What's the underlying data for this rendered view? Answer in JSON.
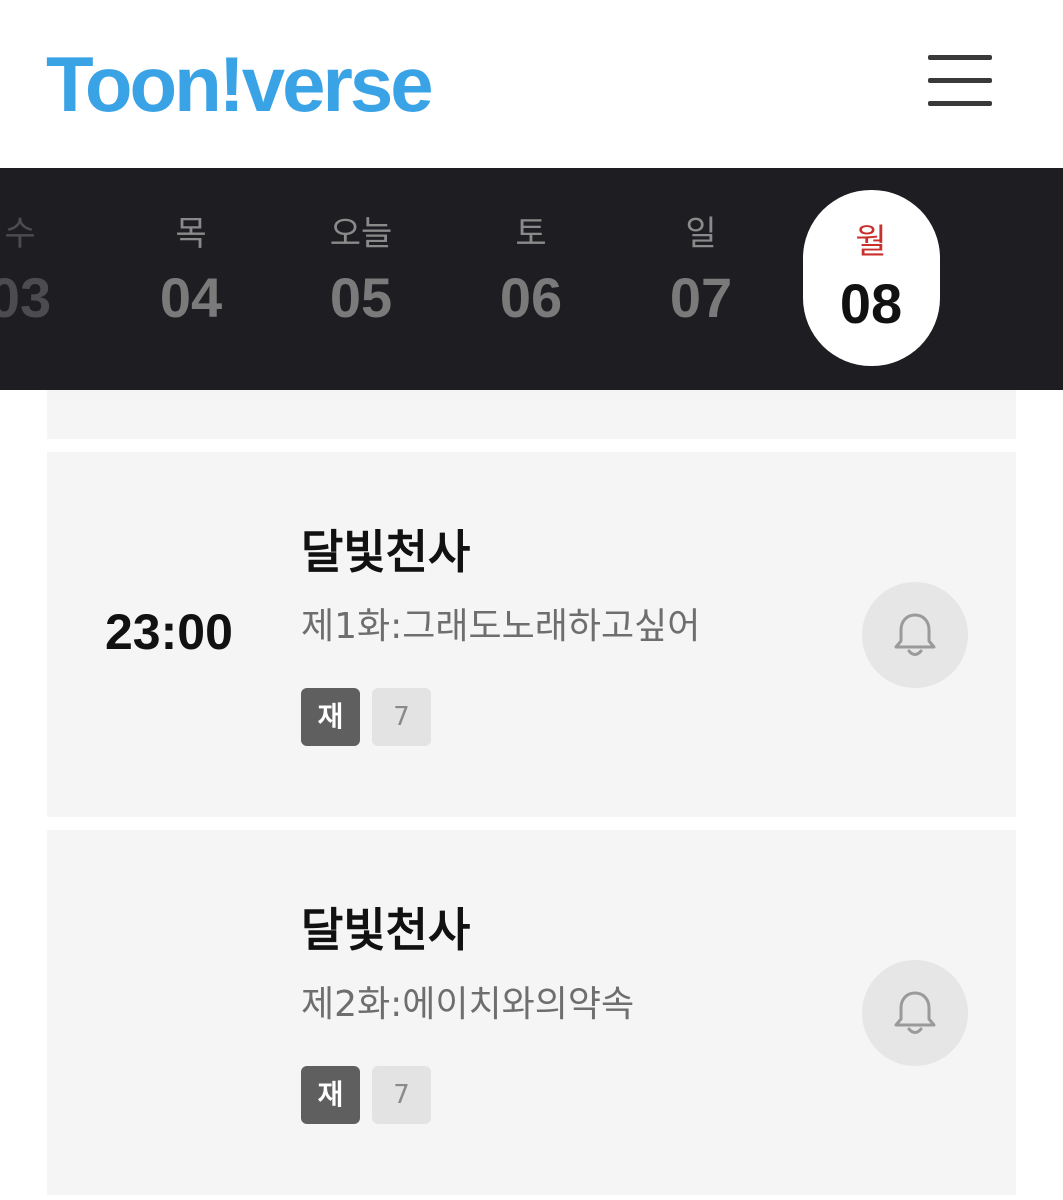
{
  "header": {
    "logo_text": "Toon!verse",
    "menu_icon": "hamburger-menu-icon"
  },
  "date_strip": {
    "days": [
      {
        "dow": "수",
        "date": "03"
      },
      {
        "dow": "목",
        "date": "04"
      },
      {
        "dow": "오늘",
        "date": "05"
      },
      {
        "dow": "토",
        "date": "06"
      },
      {
        "dow": "일",
        "date": "07"
      },
      {
        "dow": "월",
        "date": "08"
      }
    ],
    "selected_index": 5,
    "accent_color": "#c9302c"
  },
  "schedule": {
    "items": [
      {
        "time": "23:00",
        "title": "달빛천사",
        "episode": "제1화:그래도노래하고싶어",
        "rerun_badge": "재",
        "rating_badge": "7",
        "alarm_icon": "bell-icon"
      },
      {
        "time": "",
        "title": "달빛천사",
        "episode": "제2화:에이치와의약속",
        "rerun_badge": "재",
        "rating_badge": "7",
        "alarm_icon": "bell-icon"
      }
    ]
  },
  "colors": {
    "brand": "#3aa3e6",
    "strip_bg": "#1e1e22",
    "card_bg": "#f5f5f5"
  }
}
